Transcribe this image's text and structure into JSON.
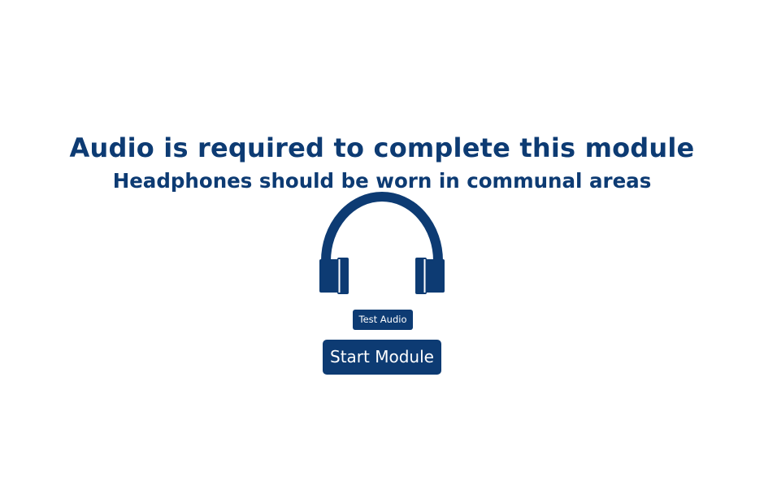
{
  "page": {
    "title": "Audio is required to complete this module",
    "subtitle": "Headphones should be worn in communal areas"
  },
  "icon": {
    "name": "headphones-icon",
    "color": "#0d3b73"
  },
  "buttons": {
    "test_audio_label": "Test Audio",
    "start_module_label": "Start Module"
  },
  "colors": {
    "accent": "#0d3b73",
    "background": "#ffffff",
    "button_text": "#ffffff"
  }
}
